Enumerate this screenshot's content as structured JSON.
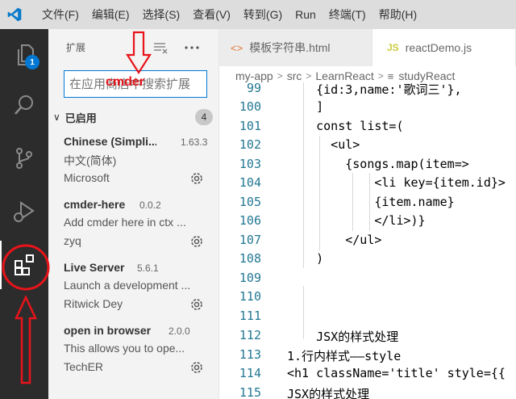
{
  "menubar": {
    "items": [
      "文件(F)",
      "编辑(E)",
      "选择(S)",
      "查看(V)",
      "转到(G)",
      "Run",
      "终端(T)",
      "帮助(H)"
    ]
  },
  "activity": {
    "explorer_badge": "1"
  },
  "sidebar": {
    "title": "扩展",
    "search_placeholder": "在应用商店中搜索扩展",
    "section_label": "已启用",
    "section_count": "4",
    "extensions": [
      {
        "name": "Chinese (Simpli...",
        "version": "1.63.3",
        "description": "中文(简体)",
        "publisher": "Microsoft"
      },
      {
        "name": "cmder-here",
        "version": "0.0.2",
        "description": "Add cmder here in ctx ...",
        "publisher": "zyq"
      },
      {
        "name": "Live Server",
        "version": "5.6.1",
        "description": "Launch a development ...",
        "publisher": "Ritwick Dey"
      },
      {
        "name": "open in browser",
        "version": "2.0.0",
        "description": "This allows you to ope...",
        "publisher": "TechER"
      }
    ]
  },
  "editor": {
    "tabs": [
      {
        "label": "模板字符串.html",
        "icon": "<>"
      },
      {
        "label": "reactDemo.js",
        "icon": "JS"
      }
    ],
    "breadcrumb": [
      "my-app",
      "src",
      "LearnReact",
      "studyReact"
    ],
    "lines": [
      {
        "num": "99",
        "text": "    {id:3,name:'歌词三'},"
      },
      {
        "num": "100",
        "text": "    ]"
      },
      {
        "num": "101",
        "text": "    const list=("
      },
      {
        "num": "102",
        "text": "      <ul>"
      },
      {
        "num": "103",
        "text": "        {songs.map(item=>"
      },
      {
        "num": "104",
        "text": "            <li key={item.id}>"
      },
      {
        "num": "105",
        "text": "            {item.name}"
      },
      {
        "num": "106",
        "text": "            </li>)}"
      },
      {
        "num": "107",
        "text": "        </ul>"
      },
      {
        "num": "108",
        "text": "    )"
      },
      {
        "num": "109",
        "text": ""
      },
      {
        "num": "110",
        "text": ""
      },
      {
        "num": "111",
        "text": ""
      },
      {
        "num": "112",
        "text": "    JSX的样式处理"
      },
      {
        "num": "113",
        "text": "1.行内样式——style"
      },
      {
        "num": "114",
        "text": "<h1 className='title' style={{"
      },
      {
        "num": "115",
        "text": "JSX的样式处理"
      }
    ]
  },
  "annotation": {
    "text": "cmder",
    "color": "#e8141a"
  }
}
